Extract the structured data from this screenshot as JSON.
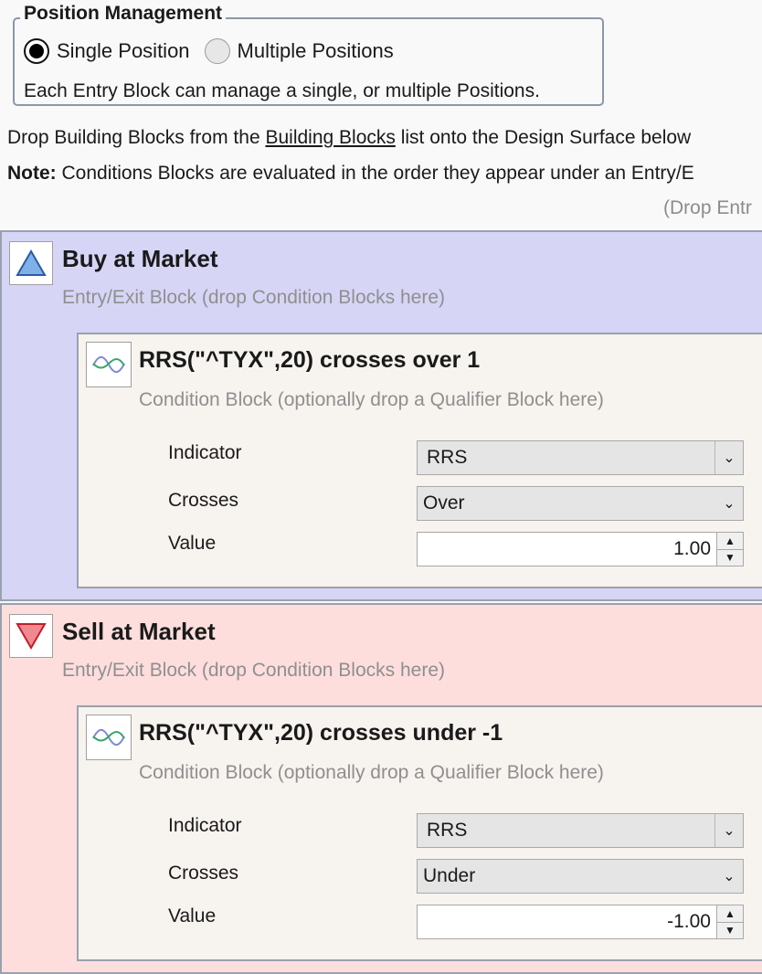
{
  "position_management": {
    "title": "Position Management",
    "options": [
      {
        "label": "Single Position",
        "checked": true
      },
      {
        "label": "Multiple Positions",
        "checked": false
      }
    ],
    "description": "Each Entry Block can manage a single, or multiple Positions."
  },
  "instructions": {
    "line1_prefix": "Drop Building Blocks from the ",
    "line1_link": "Building Blocks",
    "line1_suffix": " list onto the Design Surface below",
    "note_label": "Note:",
    "note_text": " Conditions Blocks are evaluated in the order they appear under an Entry/E",
    "drop_hint": "(Drop Entr"
  },
  "blocks": [
    {
      "title": "Buy at Market",
      "subtitle": "Entry/Exit Block (drop Condition Blocks here)",
      "icon": "triangle-up-icon",
      "color": "#d6d5f6",
      "condition": {
        "title": "RRS(\"^TYX\",20) crosses over 1",
        "subtitle": "Condition Block (optionally drop a Qualifier Block here)",
        "icon": "indicator-wave-icon",
        "fields": {
          "indicator_label": "Indicator",
          "indicator_value": "RRS",
          "crosses_label": "Crosses",
          "crosses_value": "Over",
          "value_label": "Value",
          "value_value": "1.00"
        }
      }
    },
    {
      "title": "Sell at Market",
      "subtitle": "Entry/Exit Block (drop Condition Blocks here)",
      "icon": "triangle-down-icon",
      "color": "#fddedd",
      "condition": {
        "title": "RRS(\"^TYX\",20) crosses under -1",
        "subtitle": "Condition Block (optionally drop a Qualifier Block here)",
        "icon": "indicator-wave-icon",
        "fields": {
          "indicator_label": "Indicator",
          "indicator_value": "RRS",
          "crosses_label": "Crosses",
          "crosses_value": "Under",
          "value_label": "Value",
          "value_value": "-1.00"
        }
      }
    }
  ]
}
